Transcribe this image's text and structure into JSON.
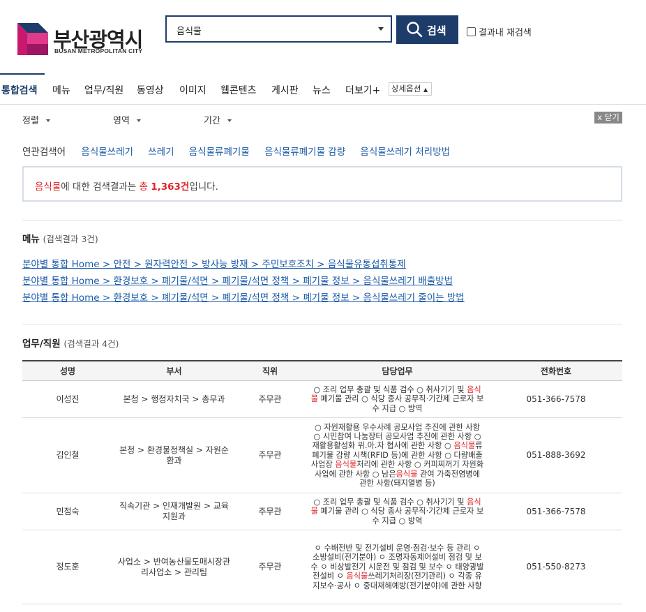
{
  "brand": {
    "name_ko": "부산광역시",
    "name_en": "BUSAN METROPOLITAN CITY",
    "colors": {
      "navy": "#1d3c6a",
      "magenta": "#c8196f",
      "highlight_red": "#e0242a",
      "link_blue": "#1a5aa8"
    }
  },
  "search": {
    "value": "음식물",
    "button_label": "검색",
    "search_icon": "search-icon",
    "research_label": "결과내 재검색",
    "research_checked": false
  },
  "tabs": [
    {
      "label": "통합검색",
      "active": true
    },
    {
      "label": "메뉴"
    },
    {
      "label": "업무/직원"
    },
    {
      "label": "동영상"
    },
    {
      "label": "이미지"
    },
    {
      "label": "웹콘텐츠"
    },
    {
      "label": "게시판"
    },
    {
      "label": "뉴스"
    },
    {
      "label": "더보기+"
    }
  ],
  "detail_option_label": "상세옵션",
  "filters": {
    "sort": "정렬",
    "area": "영역",
    "period": "기간",
    "close": "x 닫기"
  },
  "related": {
    "label": "연관검색어",
    "items": [
      "음식물쓰레기",
      "쓰레기",
      "음식물류폐기물",
      "음식물류폐기물 감량",
      "음식물쓰레기 처리방법"
    ]
  },
  "summary": {
    "term": "음식물",
    "text1": "에 대한 검색결과는 ",
    "total_prefix": "총 ",
    "count": "1,363건",
    "text2": "입니다."
  },
  "menu_section": {
    "title": "메뉴",
    "count_text": "(검색결과 3건)",
    "links": [
      "분야별 통합 Home > 안전 > 원자력안전 > 방사능 방재 > 주민보호조치 > 음식물유통섭취통제",
      "분야별 통합 Home > 환경보호 > 폐기물/석면 > 폐기물/석면 정책 > 폐기물 정보 > 음식물쓰레기 배출방법",
      "분야별 통합 Home > 환경보호 > 폐기물/석면 > 폐기물/석면 정책 > 폐기물 정보 > 음식물쓰레기 줄이는 방법"
    ]
  },
  "staff_section": {
    "title": "업무/직원",
    "count_text": "(검색결과 4건)",
    "headers": [
      "성명",
      "부서",
      "직위",
      "담당업무",
      "전화번호"
    ],
    "rows": [
      {
        "name": "이성진",
        "dept": "본청 > 행정자치국 > 총무과",
        "position": "주무관",
        "duty": [
          "○ 조리 업무 총괄 및 식품 검수 ○ 취사기기 및 ",
          {
            "hl": "음식물"
          },
          " 폐기물 관리 ○ 식당 종사 공무직·기간제 근로자 보수 지급 ○ 방역"
        ],
        "phone": "051-366-7578"
      },
      {
        "name": "김인철",
        "dept": "본청 > 환경물정책실 > 자원순환과",
        "position": "주무관",
        "duty": [
          "○ 자원재활용 우수사례 공모사업 추진에 관한 사항 ○ 시민참여 나눔장터 공모사업 추진에 관한 사항 ○ 재활용활성화 위.아.자 협사에 관한 사항 ○ ",
          {
            "hl": "음식물"
          },
          "류폐기물 감량 시책(RFID 등)에 관한 사항 ○ 다량배출사업장 ",
          {
            "hl": "음식물"
          },
          "처리에 관한 사항 ○ 커피찌꺼기 자원화 사업에 관한 사항 ○ 남은",
          {
            "hl": "음식물"
          },
          " 관여 가축전염병에 관한 사항(돼지열병 등)"
        ],
        "phone": "051-888-3692"
      },
      {
        "name": "민점숙",
        "dept": "직속기관 > 인재개발원 > 교육지원과",
        "position": "주무관",
        "duty": [
          "○ 조리 업무 총괄 및 식품 검수 ○ 취사기기 및 ",
          {
            "hl": "음식물"
          },
          " 폐기물 관리 ○ 식당 종사 공무직·기간제 근로자 보수 지급 ○ 방역"
        ],
        "phone": "051-366-7578"
      },
      {
        "name": "정도훈",
        "dept": "사업소 > 반여농산물도매시장관리사업소 > 관리팀",
        "position": "주무관",
        "duty": [
          "ㅇ 수배전반 및 전기설비 운영·점검·보수 등 관리 ㅇ 소방설비(전기분야) ㅇ 조명자동제어설비 점검 및 보수 ㅇ 비상발전기 시운전 및 점검 및 보수 ㅇ 태양광발전설비 ㅇ ",
          {
            "hl": "음식물"
          },
          "쓰레기처리장(전기관리) ㅇ 각종 유지보수·공사 ㅇ 중대재해예방(전기분야)에 관한 사항"
        ],
        "phone": "051-550-8273"
      }
    ]
  }
}
